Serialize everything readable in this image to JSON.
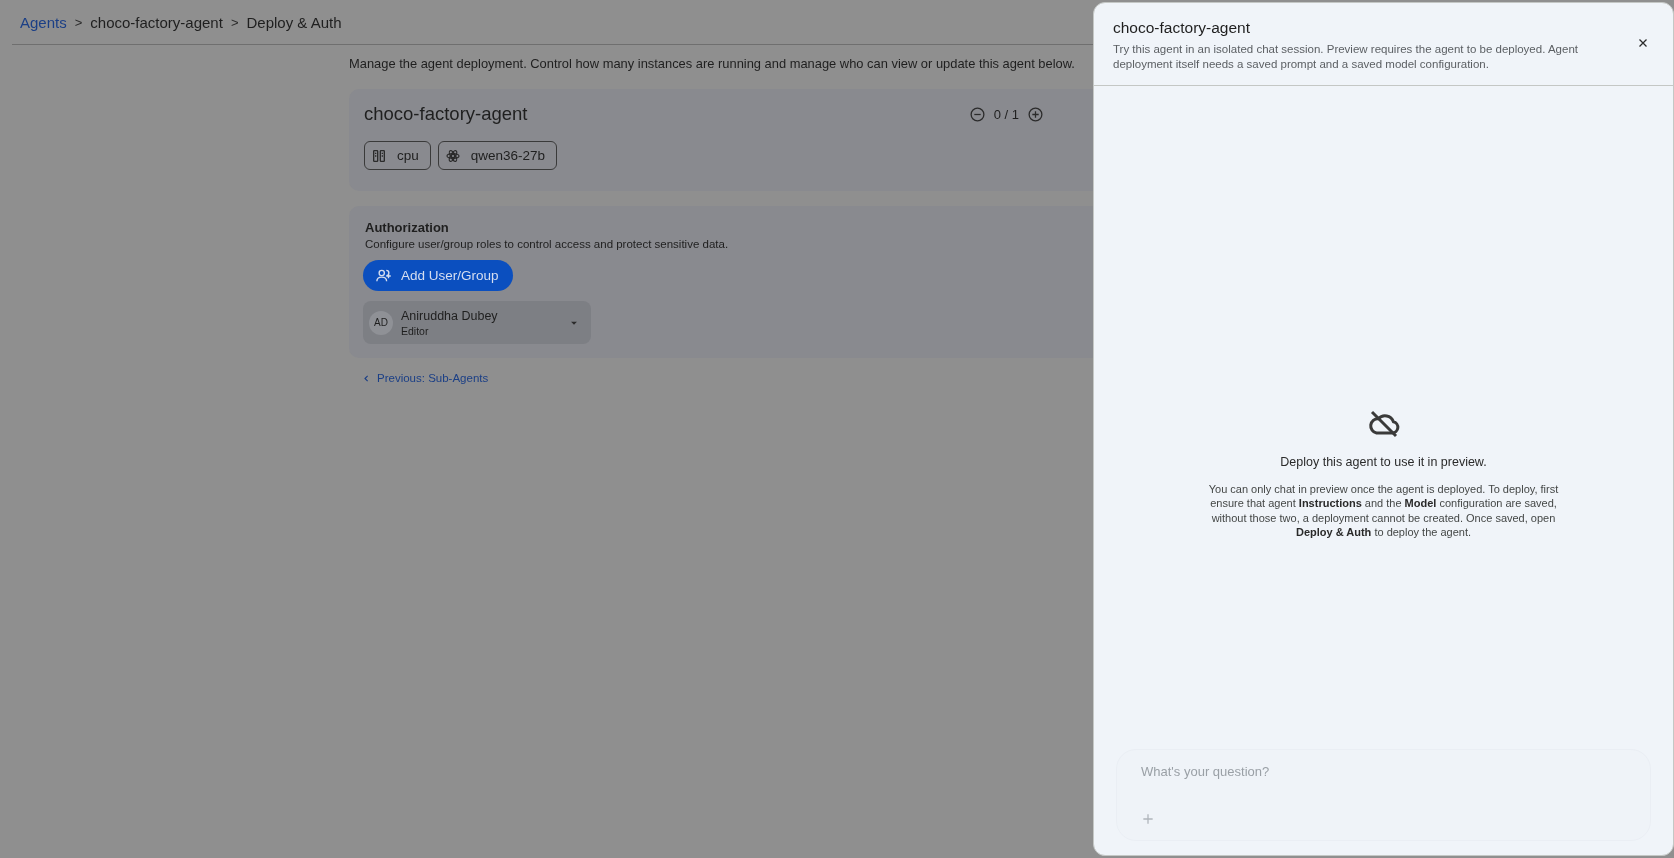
{
  "breadcrumb": [
    {
      "label": "Agents",
      "kind": "link"
    },
    {
      "label": ">",
      "kind": "separator"
    },
    {
      "label": "choco-factory-agent",
      "kind": "crumb"
    },
    {
      "label": ">",
      "kind": "separator"
    },
    {
      "label": "Deploy & Auth",
      "kind": "crumb"
    }
  ],
  "deployment": {
    "description": "Manage the agent deployment. Control how many instances are running and manage who can view or update this agent below.",
    "agent_name": "choco-factory-agent",
    "instances": "0 / 1",
    "chips": [
      {
        "label": "cpu",
        "kind": "hardware"
      },
      {
        "label": "qwen36-27b",
        "kind": "model"
      }
    ]
  },
  "authorization": {
    "title": "Authorization",
    "description": "Configure user/group roles to control access and protect sensitive data.",
    "add_button": "Add User/Group",
    "members": [
      {
        "initials": "AD",
        "name": "Aniruddha Dubey",
        "role": "Editor"
      }
    ]
  },
  "previous_link": "Previous: Sub-Agents",
  "preview_panel": {
    "title": "choco-factory-agent",
    "description": "Try this agent in an isolated chat session. Preview requires the agent to be deployed. Agent deployment itself needs a saved prompt and a saved model configuration.",
    "empty_title": "Deploy this agent to use it in preview.",
    "empty_message": "You can only chat in preview once the agent is deployed. To deploy, first ensure that agent **Instructions** and the **Model** configuration are saved, without those two, a deployment cannot be created. Once saved, open **Deploy & Auth** to deploy the agent.",
    "input": {
      "placeholder": "What's your question?"
    }
  }
}
